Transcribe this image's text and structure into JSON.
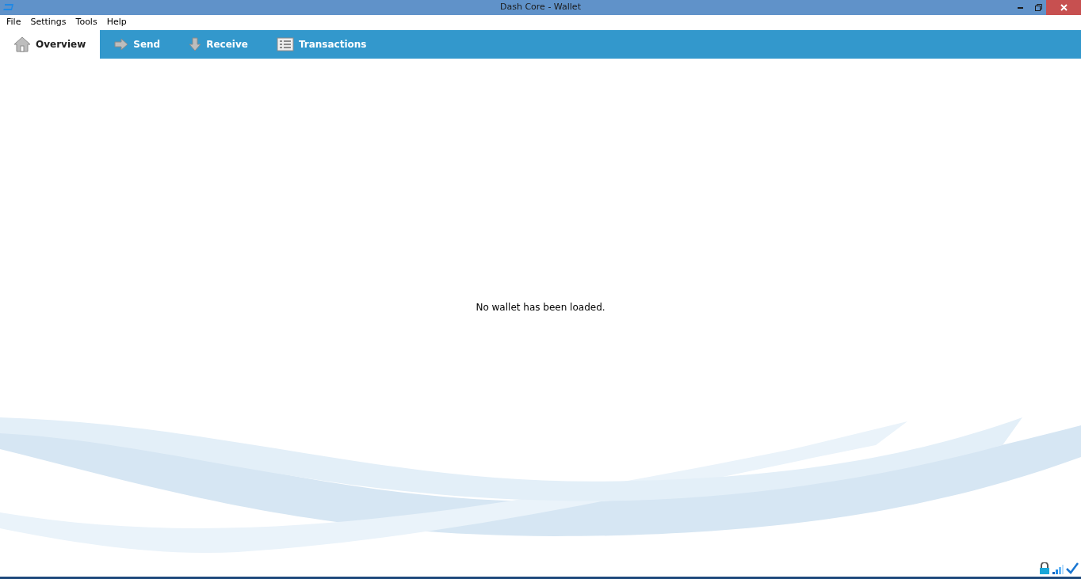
{
  "window": {
    "title": "Dash Core - Wallet"
  },
  "menu": [
    "File",
    "Settings",
    "Tools",
    "Help"
  ],
  "tabs": [
    {
      "label": "Overview",
      "kind": "home",
      "selected": true
    },
    {
      "label": "Send",
      "kind": "send",
      "selected": false
    },
    {
      "label": "Receive",
      "kind": "receive",
      "selected": false
    },
    {
      "label": "Transactions",
      "kind": "list",
      "selected": false
    }
  ],
  "message": "No wallet has been loaded."
}
